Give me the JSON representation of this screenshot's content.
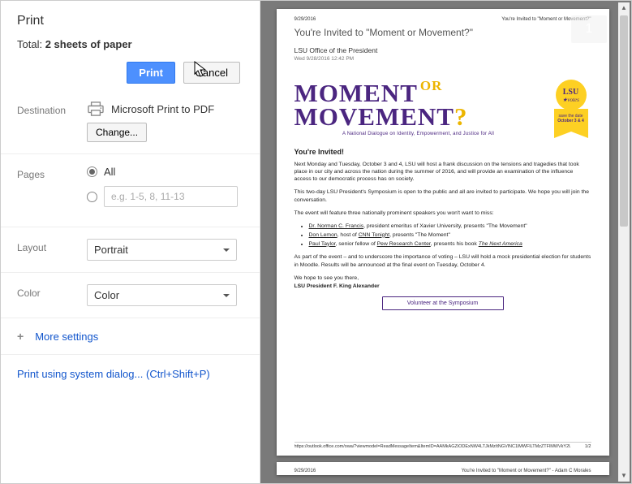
{
  "dialog": {
    "title": "Print",
    "total_prefix": "Total: ",
    "total_value": "2 sheets of paper",
    "print_btn": "Print",
    "cancel_btn": "Cancel"
  },
  "destination": {
    "label": "Destination",
    "name": "Microsoft Print to PDF",
    "change_btn": "Change..."
  },
  "pages": {
    "label": "Pages",
    "all_label": "All",
    "range_placeholder": "e.g. 1-5, 8, 11-13"
  },
  "layout": {
    "label": "Layout",
    "value": "Portrait"
  },
  "color": {
    "label": "Color",
    "value": "Color"
  },
  "more": {
    "label": "More settings"
  },
  "system_dialog": {
    "text": "Print using system dialog...",
    "accel": "(Ctrl+Shift+P)"
  },
  "preview": {
    "page_badge": "1",
    "hdr_date": "9/29/2016",
    "hdr_title": "You're Invited to \"Moment or Movement?\"",
    "doc_title": "You're Invited to \"Moment or Movement?\"",
    "from": "LSU Office of the President",
    "sent": "Wed 9/28/2016 12:42 PM",
    "hero_moment": "MOMENT",
    "hero_or": "OR",
    "hero_movement": "MOVEMENT",
    "hero_q": "?",
    "tagline": "A National Dialogue on Identity, Empowerment, and Justice for All",
    "ribbon_lsu": "LSU",
    "ribbon_votes": "votes",
    "ribbon_save": "save the date",
    "ribbon_date": "October 3 & 4",
    "body_h": "You're Invited!",
    "p1": "Next Monday and Tuesday, October 3 and 4, LSU will host a frank discussion on the tensions and tragedies that took place in our city and across the nation during the summer of 2016, and will provide an examination of the influence access to our democratic process has on society.",
    "p2": "This two-day LSU President's Symposium is open to the public and all are invited to participate. We hope you will join the conversation.",
    "p3": "The event will feature three nationally prominent speakers you won't want to miss:",
    "sp1_name": "Dr. Norman C. Francis",
    "sp1_rest": ", president emeritus of Xavier University, presents \"The Movement\"",
    "sp2_name": "Don Lemon",
    "sp2_mid": ", host of ",
    "sp2_org": "CNN Tonight",
    "sp2_rest": ", presents \"The Moment\"",
    "sp3_name": "Paul Taylor",
    "sp3_mid": ", senior fellow of ",
    "sp3_org": "Pew Research Center",
    "sp3_rest": ", presents his book ",
    "sp3_book": "The Next America",
    "p4": "As part of the event – and to underscore the importance of voting – LSU will hold a mock presidential election for students in Moodle. Results will be announced at the final event on Tuesday, October 4.",
    "p5": "We hope to see you there,",
    "p6": "LSU President F. King Alexander",
    "vol_btn": "Volunteer at the Symposium",
    "ftr_url": "https://outlook.office.com/owa/?viewmodel=ReadMessageItem&ItemID=AAMkAGZiODExNW4LTJkMzItNGVlNC1lMWFlLTMzZTFlMWVkY2U0OABGAAA...",
    "ftr_pg": "1/2",
    "p2_hdr_date": "9/29/2016",
    "p2_hdr_title": "You're Invited to \"Moment or Movement?\" - Adam C Morales"
  }
}
